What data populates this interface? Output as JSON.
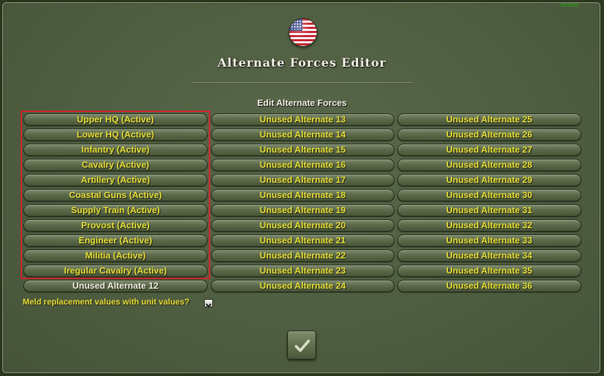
{
  "dialog": {
    "title": "Alternate Forces Editor",
    "section_label": "Edit Alternate Forces",
    "flag_icon": "us-flag-icon"
  },
  "columns": [
    [
      "Upper HQ (Active)",
      "Lower HQ (Active)",
      "Infantry (Active)",
      "Cavalry (Active)",
      "Artillery (Active)",
      "Coastal Guns (Active)",
      "Supply Train (Active)",
      "Provost (Active)",
      "Engineer (Active)",
      "Militia (Active)",
      "Iregular Cavalry (Active)",
      "Unused Alternate 12"
    ],
    [
      "Unused Alternate 13",
      "Unused Alternate 14",
      "Unused Alternate 15",
      "Unused Alternate 16",
      "Unused Alternate 17",
      "Unused Alternate 18",
      "Unused Alternate 19",
      "Unused Alternate 20",
      "Unused Alternate 21",
      "Unused Alternate 22",
      "Unused Alternate 23",
      "Unused Alternate 24"
    ],
    [
      "Unused Alternate 25",
      "Unused Alternate 26",
      "Unused Alternate 27",
      "Unused Alternate 28",
      "Unused Alternate 29",
      "Unused Alternate 30",
      "Unused Alternate 31",
      "Unused Alternate 32",
      "Unused Alternate 33",
      "Unused Alternate 34",
      "Unused Alternate 35",
      "Unused Alternate 36"
    ]
  ],
  "meld": {
    "label": "Meld replacement values with unit values?",
    "icon": "chevron-down-icon"
  },
  "confirm": {
    "icon": "checkmark-icon"
  },
  "colors": {
    "active_text": "#e7e03a",
    "unused_text": "#f2f0e4",
    "highlight_border": "#d8212a"
  }
}
